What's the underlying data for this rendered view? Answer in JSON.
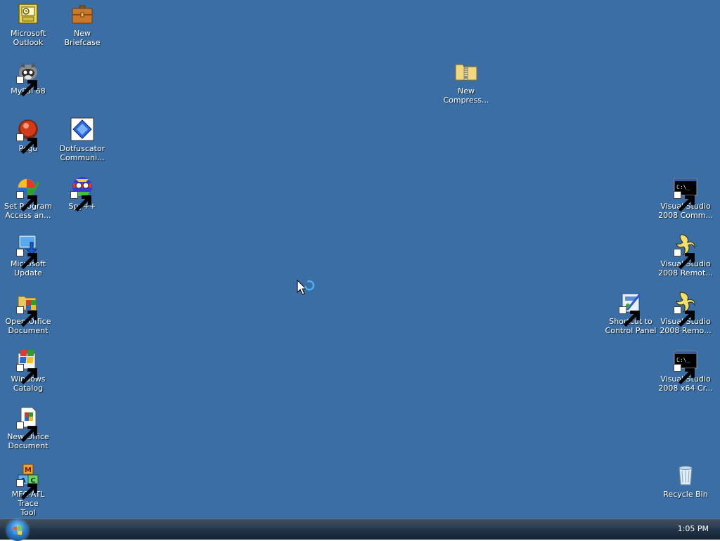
{
  "desktop": {
    "background_color": "#3a6ea5",
    "icons": [
      {
        "id": "microsoft-outlook",
        "label": "Microsoft\nOutlook",
        "icon": "outlook-icon",
        "shortcut": false
      },
      {
        "id": "new-briefcase",
        "label": "New Briefcase",
        "icon": "briefcase-icon",
        "shortcut": false
      },
      {
        "id": "mypal-68",
        "label": "MyPal 68",
        "icon": "mypal-raccoon-icon",
        "shortcut": true
      },
      {
        "id": "new-compressed-folder",
        "label": "New\nCompress...",
        "icon": "zip-folder-icon",
        "shortcut": false
      },
      {
        "id": "pego",
        "label": "Pego",
        "icon": "pego-icon",
        "shortcut": true
      },
      {
        "id": "dotfuscator",
        "label": "Dotfuscator\nCommuni...",
        "icon": "dotfuscator-icon",
        "shortcut": false
      },
      {
        "id": "set-program-access",
        "label": "Set Program\nAccess an...",
        "icon": "program-access-icon",
        "shortcut": true
      },
      {
        "id": "spy-plus-plus",
        "label": "Spy++",
        "icon": "spy-icon",
        "shortcut": true
      },
      {
        "id": "vs2008-command-prompt",
        "label": "Visual Studio\n2008 Comm...",
        "icon": "command-prompt-icon",
        "shortcut": true
      },
      {
        "id": "microsoft-update",
        "label": "Microsoft\nUpdate",
        "icon": "windows-update-icon",
        "shortcut": true
      },
      {
        "id": "vs2008-remote-1",
        "label": "Visual Studio\n2008 Remot...",
        "icon": "remote-debugger-icon",
        "shortcut": true
      },
      {
        "id": "open-office-document",
        "label": "Open Office\nDocument",
        "icon": "open-office-doc-icon",
        "shortcut": true
      },
      {
        "id": "shortcut-control-panel",
        "label": "Shortcut to\nControl Panel",
        "icon": "control-panel-icon",
        "shortcut": true
      },
      {
        "id": "vs2008-remote-2",
        "label": "Visual Studio\n2008 Remo...",
        "icon": "remote-debugger-icon",
        "shortcut": true
      },
      {
        "id": "windows-catalog",
        "label": "Windows\nCatalog",
        "icon": "windows-catalog-icon",
        "shortcut": true
      },
      {
        "id": "vs2008-x64-cross",
        "label": "Visual Studio\n2008 x64 Cr...",
        "icon": "command-prompt-icon",
        "shortcut": true
      },
      {
        "id": "new-office-document",
        "label": "New Office\nDocument",
        "icon": "new-office-doc-icon",
        "shortcut": true
      },
      {
        "id": "mfc-atl-trace",
        "label": "MFC-ATL Trace\nTool",
        "icon": "mfc-atl-icon",
        "shortcut": true
      },
      {
        "id": "recycle-bin",
        "label": "Recycle Bin",
        "icon": "recycle-bin-icon",
        "shortcut": false
      }
    ]
  },
  "taskbar": {
    "start_button": "start-orb-icon",
    "clock": "1:05 PM"
  },
  "cursor": "busy-arrow-cursor-icon"
}
